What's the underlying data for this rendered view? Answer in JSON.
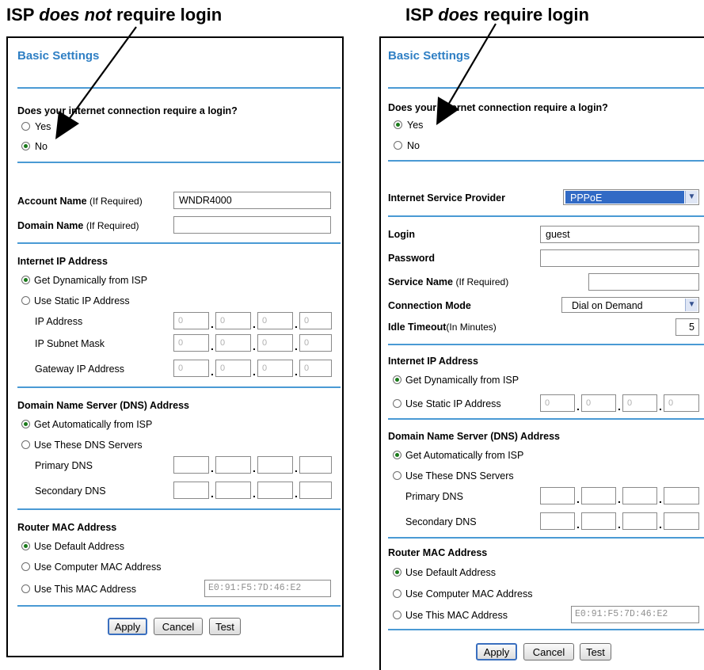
{
  "headings": {
    "left": {
      "pre": "ISP ",
      "em": "does not",
      "post": " require login"
    },
    "right": {
      "pre": "ISP ",
      "em": "does",
      "post": " require login"
    }
  },
  "left": {
    "title": "Basic Settings",
    "login_question": "Does your internet connection require a login?",
    "login_yes": "Yes",
    "login_no": "No",
    "login_selected": "No",
    "account_name_label": "Account Name",
    "account_name_hint": "(If Required)",
    "account_name_value": "WNDR4000",
    "domain_name_label": "Domain Name",
    "domain_name_hint": "(If Required)",
    "domain_name_value": "",
    "ip_section": "Internet IP Address",
    "ip_dynamic": "Get Dynamically from ISP",
    "ip_static": "Use Static IP Address",
    "ip_address_label": "IP Address",
    "subnet_label": "IP Subnet Mask",
    "gateway_label": "Gateway IP Address",
    "octet_placeholder": "0",
    "dns_section": "Domain Name Server (DNS) Address",
    "dns_auto": "Get Automatically from ISP",
    "dns_manual": "Use These DNS Servers",
    "primary_dns": "Primary DNS",
    "secondary_dns": "Secondary DNS",
    "mac_section": "Router MAC Address",
    "mac_default": "Use Default Address",
    "mac_computer": "Use Computer MAC Address",
    "mac_this": "Use This MAC Address",
    "mac_value": "E0:91:F5:7D:46:E2",
    "apply": "Apply",
    "cancel": "Cancel",
    "test": "Test"
  },
  "right": {
    "title": "Basic Settings",
    "login_question": "Does your internet connection require a login?",
    "login_yes": "Yes",
    "login_no": "No",
    "login_selected": "Yes",
    "isp_label": "Internet Service Provider",
    "isp_value": "PPPoE",
    "login_label": "Login",
    "login_value": "guest",
    "password_label": "Password",
    "service_label": "Service Name",
    "service_hint": "(If Required)",
    "connection_label": "Connection Mode",
    "connection_value": "Dial on Demand",
    "idle_label": "Idle Timeout",
    "idle_hint": "(In Minutes)",
    "idle_value": "5",
    "ip_section": "Internet IP Address",
    "ip_dynamic": "Get Dynamically from ISP",
    "ip_static": "Use Static IP Address",
    "octet_placeholder": "0",
    "dns_section": "Domain Name Server (DNS) Address",
    "dns_auto": "Get Automatically from ISP",
    "dns_manual": "Use These DNS Servers",
    "primary_dns": "Primary DNS",
    "secondary_dns": "Secondary DNS",
    "mac_section": "Router MAC Address",
    "mac_default": "Use Default Address",
    "mac_computer": "Use Computer MAC Address",
    "mac_this": "Use This MAC Address",
    "mac_value": "E0:91:F5:7D:46:E2",
    "apply": "Apply",
    "cancel": "Cancel",
    "test": "Test"
  },
  "colors": {
    "title_blue": "#2f7fc4",
    "rule_blue": "#4a9ad4",
    "radio_dot": "#1a7a1a",
    "select_highlight": "#316ac5"
  }
}
